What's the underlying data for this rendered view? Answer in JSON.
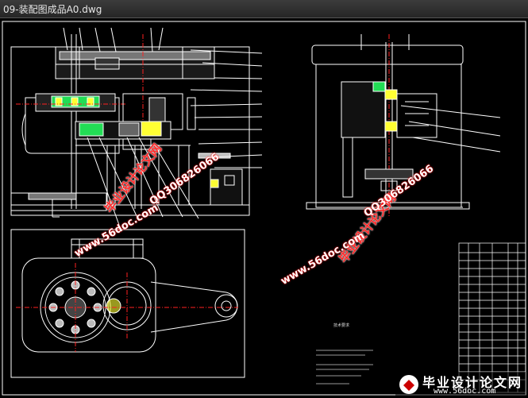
{
  "window": {
    "title": "09-装配图成品A0.dwg"
  },
  "watermarks": {
    "brand_cn": "毕业设计论文网",
    "qq": "QQ306826066",
    "url": "www.56doc.com"
  },
  "logo": {
    "name": "毕业设计论文网",
    "url": "www.56doc.com"
  },
  "tech_notes": {
    "heading": "技术要求"
  },
  "colors": {
    "line_white": "#ffffff",
    "line_green": "#00ff00",
    "line_red": "#ff2020",
    "line_yellow": "#ffff00",
    "line_cyan": "#00ffff",
    "line_magenta": "#ff00ff",
    "background": "#000000"
  }
}
